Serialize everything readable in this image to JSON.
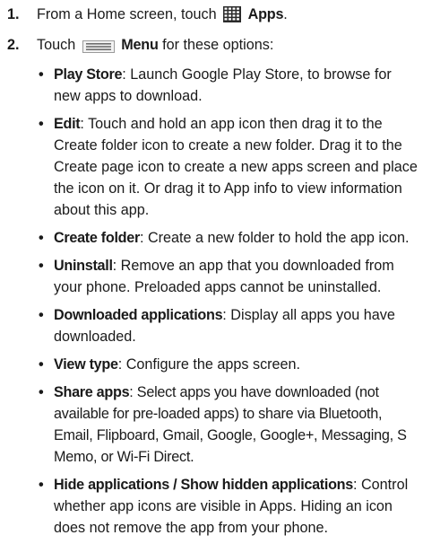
{
  "steps": [
    {
      "number": "1.",
      "text_before": "From a Home screen, touch",
      "icon": "apps-grid-icon",
      "bold": "Apps",
      "text_after": "."
    },
    {
      "number": "2.",
      "text_before": "Touch",
      "icon": "menu-icon",
      "bold": "Menu",
      "text_after": " for these options:"
    }
  ],
  "options": [
    {
      "name": "Play Store",
      "sep": ": ",
      "desc": "Launch Google Play Store, to browse for new apps to download."
    },
    {
      "name": "Edit",
      "sep": ": ",
      "desc": "Touch and hold an app icon then drag it to the Create folder icon to create a new folder. Drag it to the Create page icon to create a new apps screen and place the icon on it. Or drag it to App info to view information about this app."
    },
    {
      "name": "Create folder",
      "sep": ": ",
      "desc": "Create a new folder to hold the app icon."
    },
    {
      "name": "Uninstall",
      "sep": ": ",
      "desc": "Remove an app that you downloaded from your phone. Preloaded apps cannot be uninstalled."
    },
    {
      "name": "Downloaded applications",
      "sep": ": ",
      "desc": "Display all apps you have downloaded."
    },
    {
      "name": "View type",
      "sep": ": ",
      "desc": "Configure the apps screen."
    },
    {
      "name": "Share apps",
      "sep": ": ",
      "desc": "Select apps you have downloaded (not available for pre-loaded apps) to share via Bluetooth, Email, Flipboard, Gmail, Google, Google+, Messaging, S Memo, or Wi-Fi Direct."
    },
    {
      "name": "Hide applications / Show hidden applications",
      "sep": ": ",
      "desc": "Control whether app icons are visible in Apps. Hiding an icon does not remove the app from your phone."
    }
  ]
}
